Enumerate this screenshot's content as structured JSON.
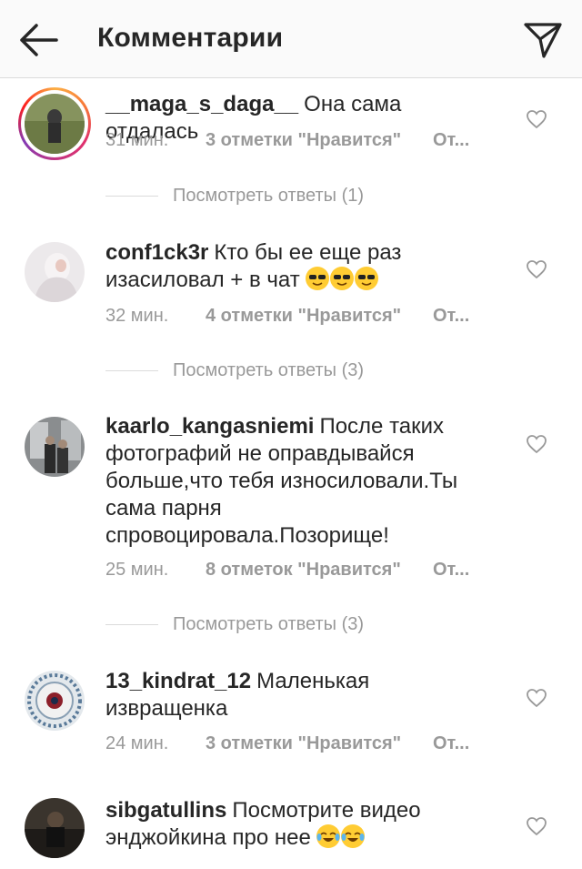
{
  "header": {
    "title": "Комментарии",
    "back_icon": "arrow-left-icon",
    "send_icon": "paper-plane-icon"
  },
  "comments": [
    {
      "username": "__maga_s_daga__",
      "text": "Она сама отдалась",
      "time": "31 мин.",
      "likes": "3 отметки \"Нравится\"",
      "reply": "От...",
      "view_replies": "Посмотреть ответы (1)",
      "has_story_ring": true,
      "avatar_color": "#7a8a5a"
    },
    {
      "username": "conf1ck3r",
      "text": "Кто бы ее еще раз изасиловал + в чат",
      "emojis": [
        "sunglasses-emoji",
        "sunglasses-emoji",
        "sunglasses-emoji"
      ],
      "time": "32 мин.",
      "likes": "4 отметки \"Нравится\"",
      "reply": "От...",
      "view_replies": "Посмотреть ответы (3)",
      "avatar_color": "#e8e4e6"
    },
    {
      "username": "kaarlo_kangasniemi",
      "text": "После таких фотографий не оправдывайся больше,что тебя износиловали.Ты сама парня спровоцировала.Позорище!",
      "time": "25 мин.",
      "likes": "8 отметок \"Нравится\"",
      "reply": "От...",
      "view_replies": "Посмотреть ответы (3)",
      "avatar_color": "#5a5e60"
    },
    {
      "username": "13_kindrat_12",
      "text": "Маленькая извращенка",
      "time": "24 мин.",
      "likes": "3 отметки \"Нравится\"",
      "reply": "От...",
      "avatar_color": "#c9d2da"
    },
    {
      "username": "sibgatullins",
      "text": "Посмотрите видео энджойкина про нее",
      "emojis": [
        "tears-of-joy-emoji",
        "tears-of-joy-emoji"
      ],
      "avatar_color": "#2e2a26"
    }
  ]
}
